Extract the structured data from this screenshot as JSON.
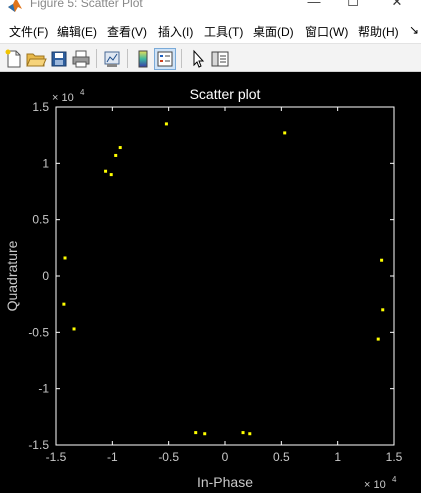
{
  "window": {
    "title": "Figure 5: Scatter Plot",
    "minimize": "—",
    "maximize": "☐",
    "close": "✕"
  },
  "menu": {
    "items": [
      {
        "label": "文件(F)"
      },
      {
        "label": "编辑(E)"
      },
      {
        "label": "查看(V)"
      },
      {
        "label": "插入(I)"
      },
      {
        "label": "工具(T)"
      },
      {
        "label": "桌面(D)"
      },
      {
        "label": "窗口(W)"
      },
      {
        "label": "帮助(H)"
      }
    ],
    "overflow": "↘"
  },
  "toolbar": {
    "buttons": [
      {
        "icon": "new-figure-icon"
      },
      {
        "icon": "open-folder-icon"
      },
      {
        "icon": "save-icon"
      },
      {
        "icon": "print-icon"
      },
      {
        "icon": "link-plot-icon"
      },
      {
        "icon": "insert-colorbar-icon"
      },
      {
        "icon": "insert-legend-icon"
      },
      {
        "icon": "pointer-icon"
      },
      {
        "icon": "property-editor-icon"
      }
    ],
    "active": "insert-legend-icon"
  },
  "chart_data": {
    "type": "scatter",
    "title": "Scatter plot",
    "xlabel": "In-Phase",
    "ylabel": "Quadrature",
    "xlim": [
      -15000,
      15000
    ],
    "ylim": [
      -15000,
      15000
    ],
    "x_exponent_label": "× 10",
    "x_exponent_power": "4",
    "y_exponent_label": "× 10",
    "y_exponent_power": "4",
    "xticks": [
      -1.5,
      -1,
      -0.5,
      0,
      0.5,
      1,
      1.5
    ],
    "xtick_labels": [
      "-1.5",
      "-1",
      "-0.5",
      "0",
      "0.5",
      "1",
      "1.5"
    ],
    "yticks": [
      -1.5,
      -1,
      -0.5,
      0,
      0.5,
      1,
      1.5
    ],
    "ytick_labels": [
      "-1.5",
      "-1",
      "-0.5",
      "0",
      "0.5",
      "1",
      "1.5"
    ],
    "grid": false,
    "background": "#000000",
    "axis_color": "#ffffff",
    "tick_label_color": "#c8c8c8",
    "marker_color": "#ffff00",
    "series": [
      {
        "x": [
          -5200,
          5300,
          -10600,
          -10100,
          -9700,
          -9300,
          -14200,
          -14300,
          -13400,
          13900,
          14000,
          13600,
          -2600,
          -1800,
          1600,
          2200
        ],
        "y": [
          13500,
          12700,
          9300,
          9000,
          10700,
          11400,
          1600,
          -2500,
          -4700,
          1400,
          -3000,
          -5600,
          -13900,
          -14000,
          -13900,
          -14000
        ]
      }
    ]
  }
}
